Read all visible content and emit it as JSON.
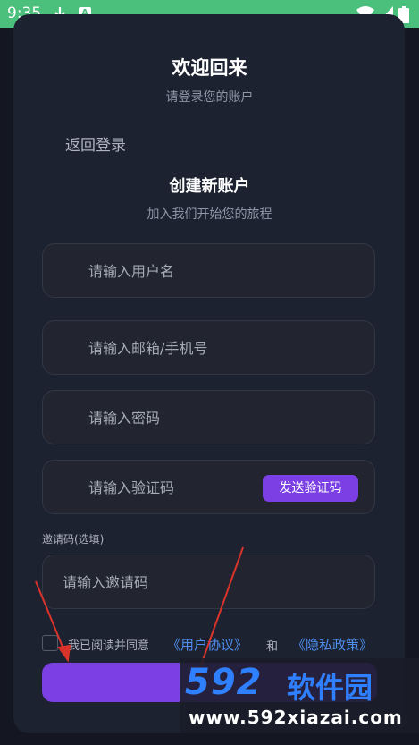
{
  "status_bar": {
    "time": "9:35",
    "notification_badge": "A"
  },
  "header": {
    "title": "欢迎回来",
    "subtitle": "请登录您的账户"
  },
  "back_link": "返回登录",
  "register": {
    "title": "创建新账户",
    "subtitle": "加入我们开始您的旅程",
    "username_placeholder": "请输入用户名",
    "email_phone_placeholder": "请输入邮箱/手机号",
    "password_placeholder": "请输入密码",
    "code_placeholder": "请输入验证码",
    "send_code_label": "发送验证码",
    "invite_label": "邀请码(选填)",
    "invite_placeholder": "请输入邀请码",
    "agree_text": "我已阅读并同意",
    "user_agreement_link": "《用户协议》",
    "and_text": "和",
    "privacy_link": "《隐私政策》"
  },
  "watermark": {
    "logo": "592",
    "name": "软件园",
    "url": "www.592xiazai.com"
  },
  "colors": {
    "accent": "#7b3fe4",
    "status_bar": "#4bc07d",
    "link": "#4f8ff0",
    "background": "#141722",
    "card": "#1c2230"
  }
}
